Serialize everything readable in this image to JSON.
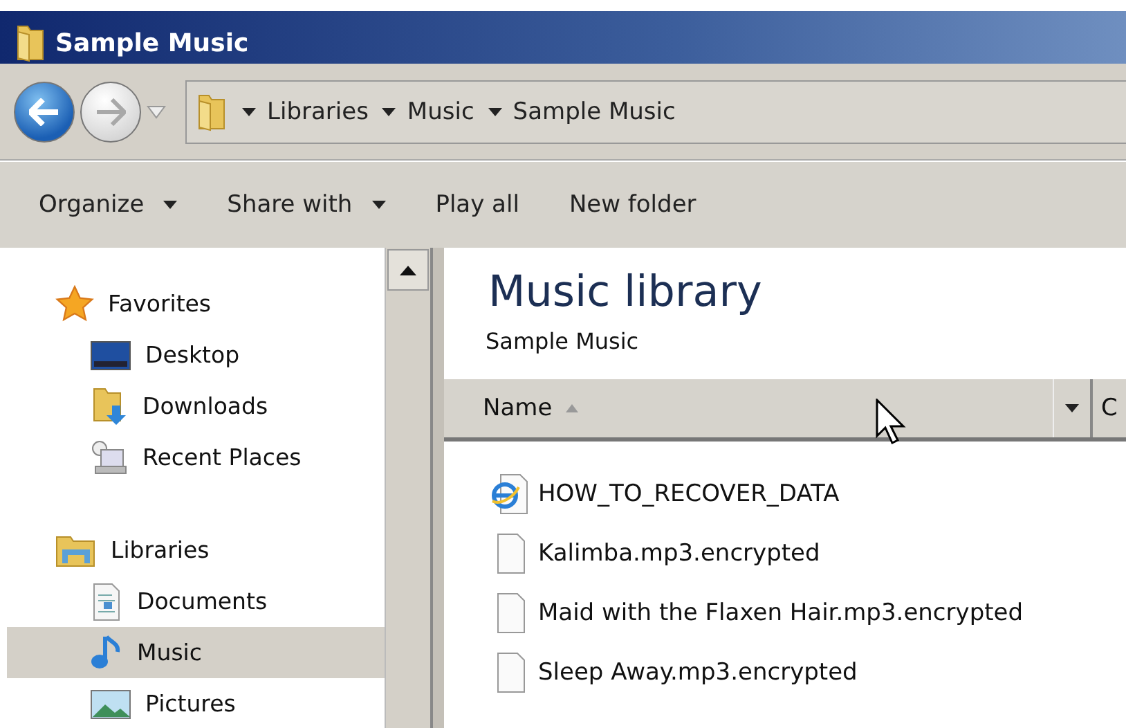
{
  "window": {
    "title": "Sample Music"
  },
  "address_bar": {
    "crumbs": [
      "Libraries",
      "Music",
      "Sample Music"
    ]
  },
  "toolbar": {
    "items": [
      {
        "label": "Organize",
        "has_menu": true
      },
      {
        "label": "Share with",
        "has_menu": true
      },
      {
        "label": "Play all",
        "has_menu": false
      },
      {
        "label": "New folder",
        "has_menu": false
      }
    ]
  },
  "sidebar": {
    "groups": [
      {
        "label": "Favorites",
        "children": [
          {
            "label": "Desktop",
            "selected": false
          },
          {
            "label": "Downloads",
            "selected": false
          },
          {
            "label": "Recent Places",
            "selected": false
          }
        ]
      },
      {
        "label": "Libraries",
        "children": [
          {
            "label": "Documents",
            "selected": false
          },
          {
            "label": "Music",
            "selected": true
          },
          {
            "label": "Pictures",
            "selected": false
          }
        ]
      }
    ]
  },
  "content": {
    "title": "Music library",
    "subtitle": "Sample Music",
    "columns": [
      {
        "label": "Name",
        "sorted": true
      },
      {
        "label": "C",
        "sorted": false
      }
    ],
    "files": [
      {
        "name": "HOW_TO_RECOVER_DATA",
        "kind": "webpage"
      },
      {
        "name": "Kalimba.mp3.encrypted",
        "kind": "file"
      },
      {
        "name": "Maid with the Flaxen Hair.mp3.encrypted",
        "kind": "file"
      },
      {
        "name": "Sleep Away.mp3.encrypted",
        "kind": "file"
      }
    ]
  }
}
